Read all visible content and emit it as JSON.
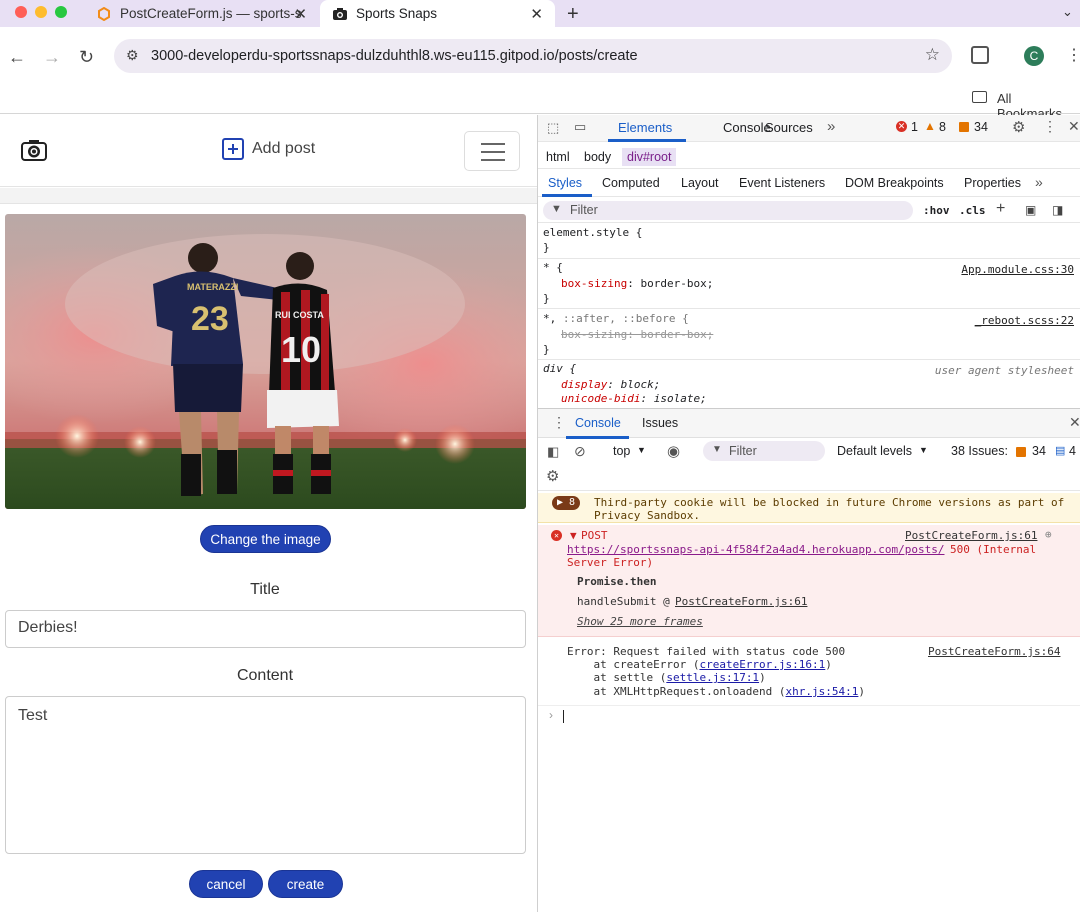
{
  "browser": {
    "tabs": [
      {
        "title": "PostCreateForm.js — sports-s",
        "active": false
      },
      {
        "title": "Sports Snaps",
        "active": true
      }
    ],
    "url": "3000-developerdu-sportssnaps-dulzduhthl8.ws-eu115.gitpod.io/posts/create",
    "profile_initial": "C",
    "bookmarks_label": "All Bookmarks"
  },
  "app": {
    "nav": {
      "add_post_label": "Add post"
    },
    "change_image_label": "Change the image",
    "title_label": "Title",
    "title_value": "Derbies!",
    "content_label": "Content",
    "content_value": "Test",
    "cancel_label": "cancel",
    "create_label": "create",
    "photo_jerseys": {
      "left_name": "MATERAZZI",
      "left_number": "23",
      "right_name": "RUI COSTA",
      "right_number": "10"
    }
  },
  "devtools": {
    "tabs": [
      "Elements",
      "Console",
      "Sources"
    ],
    "more_tabs": "»",
    "errors_count": "1",
    "warnings_count": "8",
    "issues_count": "34",
    "breadcrumb": [
      "html",
      "body",
      "div#root"
    ],
    "subtabs": [
      "Styles",
      "Computed",
      "Layout",
      "Event Listeners",
      "DOM Breakpoints",
      "Properties"
    ],
    "filter_placeholder": "Filter",
    "hov": ":hov",
    "cls": ".cls",
    "styles": {
      "element_style": "element.style {",
      "close": "}",
      "rule1_selector": "* {",
      "rule1_source": "App.module.css:30",
      "rule1_prop": "box-sizing",
      "rule1_value": "border-box;",
      "rule2_selector_a": "*,",
      "rule2_selector_b": "::after, ::before {",
      "rule2_source": "_reboot.scss:22",
      "rule2_decl": "box-sizing: border-box;",
      "rule3_selector": "div {",
      "rule3_source": "user agent stylesheet",
      "rule3_prop1": "display",
      "rule3_val1": "block;",
      "rule3_prop2": "unicode-bidi",
      "rule3_val2": "isolate;"
    },
    "drawer": {
      "tabs": [
        "Console",
        "Issues"
      ],
      "context": "top",
      "filter": "Filter",
      "levels": "Default levels",
      "issues_text": "38 Issues:",
      "issues_warn": "34",
      "issues_info": "4",
      "cookie_badge": "8",
      "cookie_msg_1": "Third-party cookie will be blocked in future Chrome versions as part of",
      "cookie_msg_2": "Privacy Sandbox.",
      "post_label": "POST",
      "post_source": "PostCreateForm.js:61",
      "post_url": "https://sportssnaps-api-4f584f2a4ad4.herokuapp.com/posts/",
      "post_status_1": "500 (Internal",
      "post_status_2": "Server Error)",
      "promise_then": "Promise.then",
      "handle_submit": "handleSubmit @",
      "handle_submit_link": "PostCreateForm.js:61",
      "more_frames": "Show 25 more frames",
      "error_line": "Error: Request failed with status code 500",
      "error_source": "PostCreateForm.js:64",
      "stack1_pre": "    at createError (",
      "stack1_link": "createError.js:16:1",
      "stack2_pre": "    at settle (",
      "stack2_link": "settle.js:17:1",
      "stack3_pre": "    at XMLHttpRequest.onloadend (",
      "stack3_link": "xhr.js:54:1"
    }
  },
  "colors": {
    "accent": "#2142b2",
    "tabbar": "#e8e0f4",
    "error": "#d93025",
    "warn": "#e37400"
  }
}
